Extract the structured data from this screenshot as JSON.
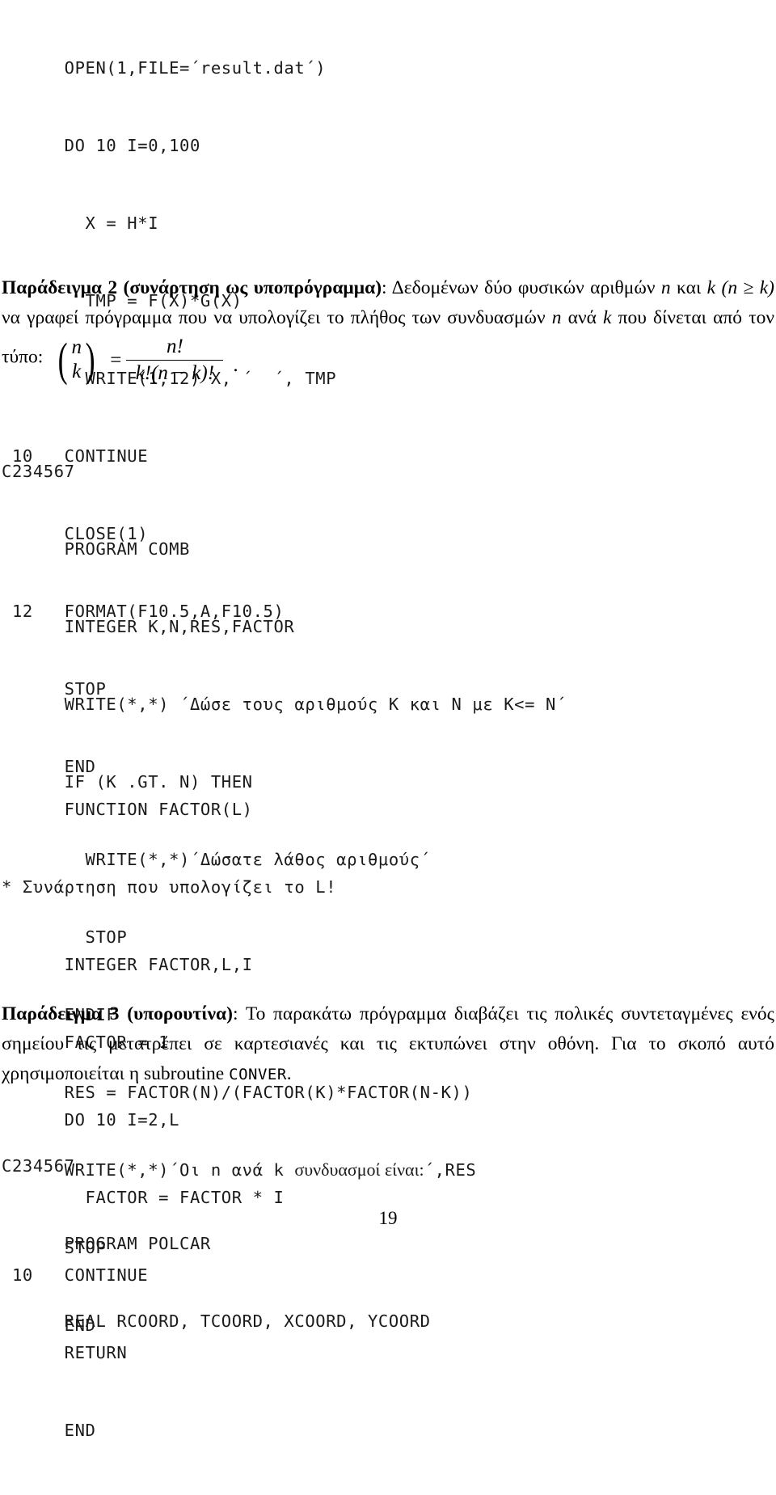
{
  "document": {
    "page_number": "19",
    "language": "el"
  },
  "code_block_1": {
    "name": "fortran-listing-trapezoid-io",
    "lines": [
      "      OPEN(1,FILE=´result.dat´)",
      "      DO 10 I=0,100",
      "        X = H*I",
      "        TMP = F(X)*G(X)",
      "        WRITE(1,12) X, ´  ´, TMP",
      " 10   CONTINUE",
      "      CLOSE(1)",
      " 12   FORMAT(F10.5,A,F10.5)",
      "      STOP",
      "      END"
    ]
  },
  "paragraph_2": {
    "label": "Παράδειγμα 2 (συνάρτηση ως υποπρόγραμμα)",
    "colon": ": ",
    "text_part_1": "Δεδομένων δύο φυσικών αριθμών ",
    "var_n_1": "n",
    "text_part_2": " και ",
    "var_k_1": "k (n ≥ k)",
    "text_part_3": " να γραφεί πρόγραμμα που να υπολογίζει το πλήθος των συνδυασμών ",
    "var_n_2": "n",
    "text_part_4": " ανά ",
    "var_k_2": "k",
    "text_part_5": " που δίνεται από τον τύπο: ",
    "formula": {
      "binom_top": "n",
      "binom_bottom": "k",
      "equals": "=",
      "numerator": "n!",
      "denominator": "k!(n − k)!",
      "trailing": "."
    }
  },
  "code_block_2": {
    "name": "fortran-listing-comb",
    "header": "C234567",
    "lines": [
      "      PROGRAM COMB",
      "      INTEGER K,N,RES,FACTOR",
      "      WRITE(*,*) ´Δώσε τους αριθμούς Κ και Ν με Κ<= Ν´",
      "      IF (K .GT. N) THEN",
      "        WRITE(*,*)´Δώσατε λάθος αριθμούς´",
      "        STOP",
      "      ENDIF",
      "      RES = FACTOR(N)/(FACTOR(K)*FACTOR(N-K))",
      "      STOP",
      "      END"
    ],
    "write_combo_line": {
      "prefix": "      WRITE(*,*)´Οι n ανά k ",
      "serif_part": "συνδυασμοί είναι:",
      "suffix": "´,RES"
    }
  },
  "code_block_3": {
    "name": "fortran-listing-function-factor",
    "lines": [
      "      FUNCTION FACTOR(L)",
      "* Συνάρτηση που υπολογίζει το L!",
      "      INTEGER FACTOR,L,I",
      "      FACTOR = 1",
      "      DO 10 I=2,L",
      "        FACTOR = FACTOR * I",
      " 10   CONTINUE",
      "      RETURN",
      "      END"
    ]
  },
  "paragraph_3": {
    "label": "Παράδειγμα 3 (υπορουτίνα)",
    "colon": ": ",
    "text_part_1": "Το παρακάτω πρόγραμμα διαβάζει τις πολικές συντεταγμένες ενός σημείου τις μετατρέπει σε καρτεσιανές και τις εκτυπώνει στην οθόνη. Για το σκοπό αυτό χρησιμοποιείται η subroutine ",
    "mono_term": "CONVER",
    "text_part_2": "."
  },
  "code_block_4": {
    "name": "fortran-listing-polcar",
    "header": "C234567",
    "lines": [
      "      PROGRAM POLCAR",
      "      REAL RCOORD, TCOORD, XCOORD, YCOORD"
    ]
  }
}
